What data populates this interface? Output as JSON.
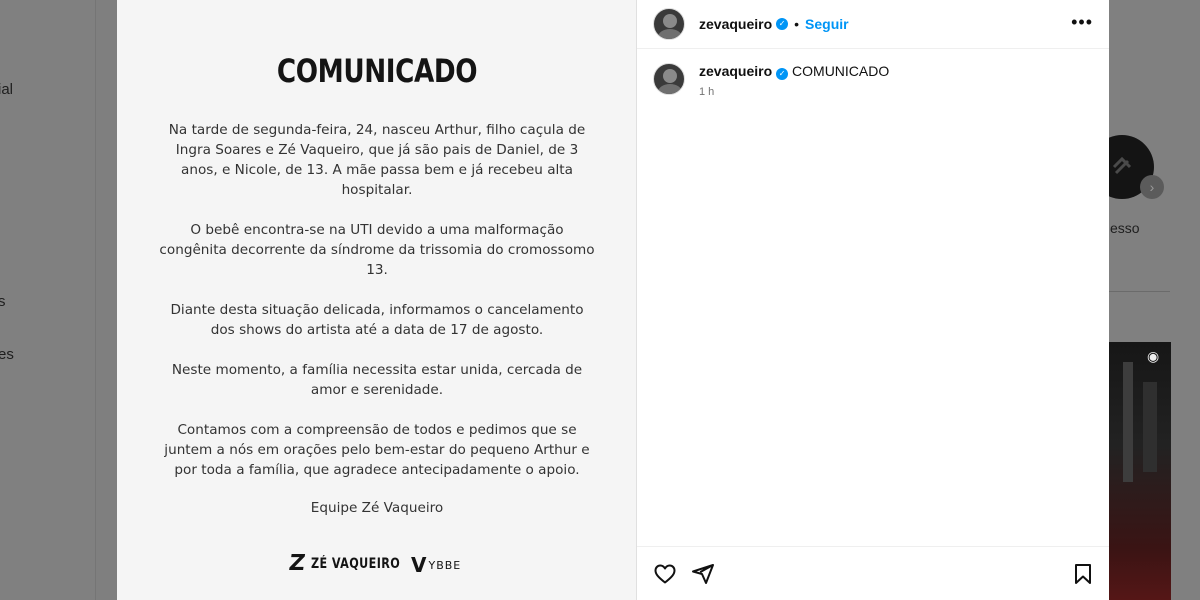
{
  "background": {
    "sidebar_fragments": [
      "ial",
      "s",
      "es"
    ],
    "right_fragment": "esso"
  },
  "document": {
    "title": "COMUNICADO",
    "paragraphs": [
      "Na tarde de segunda-feira, 24, nasceu Arthur, filho caçula de Ingra Soares e Zé Vaqueiro, que já são pais de Daniel, de 3 anos, e Nicole, de 13. A mãe passa bem e já recebeu alta hospitalar.",
      "O bebê encontra-se na UTI devido a uma malformação congênita decorrente da síndrome da trissomia do cromossomo 13.",
      "Diante desta situação delicada, informamos o cancelamento dos shows do artista até a data de 17 de agosto.",
      "Neste momento, a família necessita estar unida, cercada de amor e serenidade.",
      "Contamos com a compreensão de todos e pedimos que se juntem a nós em orações pelo bem-estar do pequeno Arthur e por toda a família, que agradece antecipadamente o apoio."
    ],
    "signoff": "Equipe Zé Vaqueiro",
    "logo_ze_mark": "Z",
    "logo_ze_text": "ZÉ VAQUEIRO",
    "logo_ybbe_mark": "V",
    "logo_ybbe_text": "YBBE"
  },
  "post": {
    "username": "zevaqueiro",
    "separator": "•",
    "follow_label": "Seguir",
    "more_label": "•••",
    "caption_text": "COMUNICADO",
    "time": "1 h"
  },
  "icons": {
    "verified": "verified-badge-icon",
    "like": "heart-icon",
    "share": "send-icon",
    "save": "bookmark-icon"
  },
  "colors": {
    "accent": "#0095f6",
    "overlay": "#7f7f7f"
  }
}
